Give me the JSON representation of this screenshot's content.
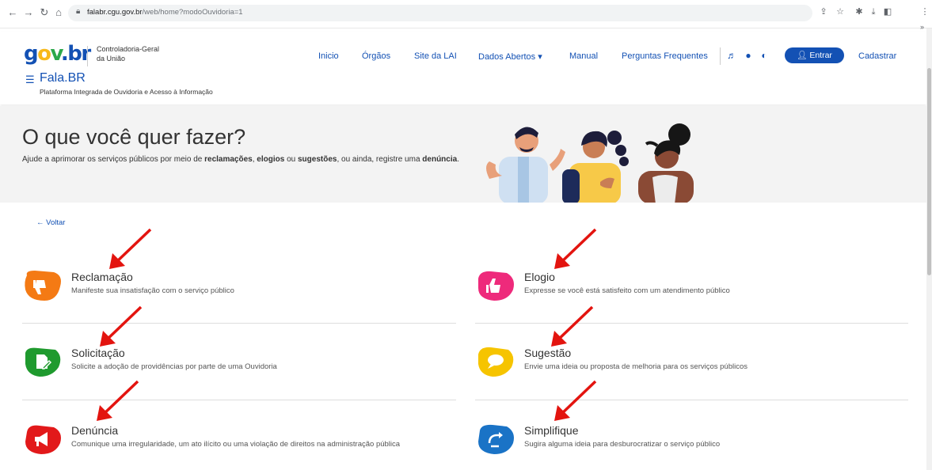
{
  "browser": {
    "url_host": "falabr.cgu.gov.br",
    "url_path": "/web/home?modoOuvidoria=1"
  },
  "header": {
    "org_line1": "Controladoria-Geral",
    "org_line2": "da União",
    "app_title": "Fala.BR",
    "app_subtitle": "Plataforma Integrada de Ouvidoria e Acesso à Informação",
    "nav": [
      "Inicio",
      "Órgãos",
      "Site da LAI",
      "Dados Abertos ▾",
      "Manual",
      "Perguntas Frequentes"
    ],
    "entrar": "Entrar",
    "cadastrar": "Cadastrar"
  },
  "hero": {
    "title": "O que você quer fazer?",
    "text_pre": "Ajude a aprimorar os serviços públicos por meio de ",
    "kw1": "reclamações",
    "sep1": ", ",
    "kw2": "elogios",
    "sep2": " ou ",
    "kw3": "sugestões",
    "text_mid": ", ou ainda, registre uma ",
    "kw4": "denúncia",
    "text_end": "."
  },
  "voltar": "← Voltar",
  "services": [
    {
      "title": "Reclamação",
      "desc": "Manifeste sua insatisfação com o serviço público",
      "color": "#f47a14"
    },
    {
      "title": "Elogio",
      "desc": "Expresse se você está satisfeito com um atendimento público",
      "color": "#ee2a7b"
    },
    {
      "title": "Solicitação",
      "desc": "Solicite a adoção de providências por parte de uma Ouvidoria",
      "color": "#1f9a2e"
    },
    {
      "title": "Sugestão",
      "desc": "Envie uma ideia ou proposta de melhoria para os serviços públicos",
      "color": "#f6c400"
    },
    {
      "title": "Denúncia",
      "desc": "Comunique uma irregularidade, um ato ilícito ou uma violação de direitos na administração pública",
      "color": "#e2191a"
    },
    {
      "title": "Simplifique",
      "desc": "Sugira alguma ideia para desburocratizar o serviço público",
      "color": "#1a73c6"
    }
  ],
  "colors": {
    "brand_blue": "#1351b4",
    "annotation_arrow": "#e3140f"
  }
}
